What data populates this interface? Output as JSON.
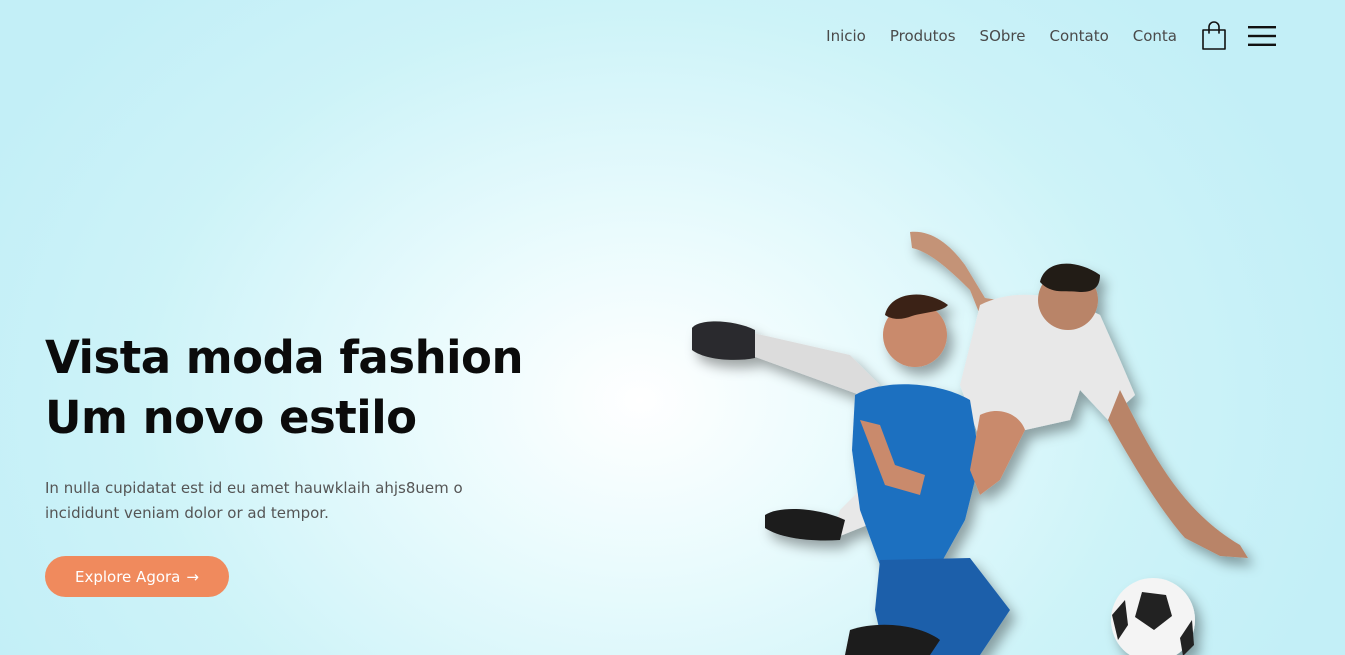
{
  "nav": {
    "items": [
      "Inicio",
      "Produtos",
      "SObre",
      "Contato",
      "Conta"
    ],
    "cart_icon": "shopping-bag-icon",
    "menu_icon": "hamburger-menu-icon"
  },
  "hero": {
    "title_line1": "Vista moda fashion",
    "title_line2": "Um novo estilo",
    "text": "In nulla cupidatat est id eu amet hauwklaih ahjs8uem o incididunt veniam dolor or ad tempor.",
    "cta_label": "Explore Agora",
    "cta_arrow": "→"
  },
  "colors": {
    "accent": "#f08a5d",
    "background": "#c3eff7",
    "title": "#0b0b0b"
  }
}
